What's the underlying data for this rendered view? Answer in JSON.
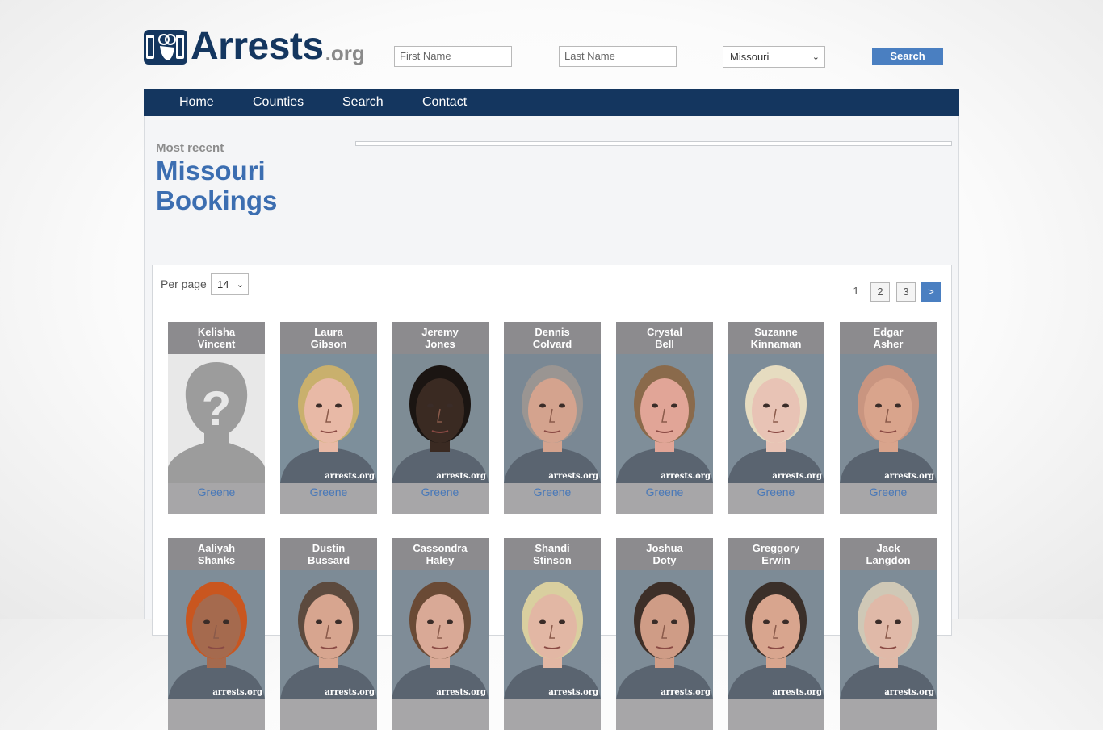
{
  "header": {
    "logo_word": "Arrests",
    "logo_tld": ".org",
    "first_name_placeholder": "First Name",
    "last_name_placeholder": "Last Name",
    "state_selected": "Missouri",
    "search_label": "Search"
  },
  "nav": {
    "items": [
      "Home",
      "Counties",
      "Search",
      "Contact"
    ]
  },
  "main": {
    "eyebrow": "Most recent",
    "title_line1": "Missouri",
    "title_line2": "Bookings"
  },
  "listing": {
    "per_page_label": "Per page",
    "per_page_value": "14",
    "pagination": {
      "current": "1",
      "pages": [
        "2",
        "3"
      ],
      "next": ">"
    },
    "watermark": "arrests.org",
    "cards": [
      {
        "first": "Kelisha",
        "last": "Vincent",
        "county": "Greene",
        "photo": "placeholder-silhouette",
        "bg": "#e8e8e8",
        "skin": "",
        "hair": ""
      },
      {
        "first": "Laura",
        "last": "Gibson",
        "county": "Greene",
        "photo": "mugshot",
        "bg": "#7d8f9b",
        "skin": "#e8b9a6",
        "hair": "#c9b06d"
      },
      {
        "first": "Jeremy",
        "last": "Jones",
        "county": "Greene",
        "photo": "mugshot",
        "bg": "#7e8c95",
        "skin": "#3a2a22",
        "hair": "#1b1512"
      },
      {
        "first": "Dennis",
        "last": "Colvard",
        "county": "Greene",
        "photo": "mugshot",
        "bg": "#7a8894",
        "skin": "#d4a38e",
        "hair": "#9a9592"
      },
      {
        "first": "Crystal",
        "last": "Bell",
        "county": "Greene",
        "photo": "mugshot",
        "bg": "#7f8e99",
        "skin": "#e1a597",
        "hair": "#8a6a4b"
      },
      {
        "first": "Suzanne",
        "last": "Kinnaman",
        "county": "Greene",
        "photo": "mugshot",
        "bg": "#7d8c98",
        "skin": "#e8c3b5",
        "hair": "#e6dcc0"
      },
      {
        "first": "Edgar",
        "last": "Asher",
        "county": "Greene",
        "photo": "mugshot",
        "bg": "#7e8c97",
        "skin": "#d9a48c",
        "hair": "#c99580"
      },
      {
        "first": "Aaliyah",
        "last": "Shanks",
        "county": "",
        "photo": "mugshot",
        "bg": "#7f8d98",
        "skin": "#a56a4e",
        "hair": "#c9561f"
      },
      {
        "first": "Dustin",
        "last": "Bussard",
        "county": "",
        "photo": "mugshot",
        "bg": "#7d8b96",
        "skin": "#d7a58f",
        "hair": "#5c4a3e"
      },
      {
        "first": "Cassondra",
        "last": "Haley",
        "county": "",
        "photo": "mugshot",
        "bg": "#7f8c97",
        "skin": "#d9a996",
        "hair": "#6a4a35"
      },
      {
        "first": "Shandi",
        "last": "Stinson",
        "county": "",
        "photo": "mugshot",
        "bg": "#7d8b97",
        "skin": "#e2b7a4",
        "hair": "#d9cf9f"
      },
      {
        "first": "Joshua",
        "last": "Doty",
        "county": "",
        "photo": "mugshot",
        "bg": "#7e8c97",
        "skin": "#cf9c86",
        "hair": "#3d2f28"
      },
      {
        "first": "Greggory",
        "last": "Erwin",
        "county": "",
        "photo": "mugshot",
        "bg": "#7d8b96",
        "skin": "#d8a58e",
        "hair": "#3a2f29"
      },
      {
        "first": "Jack",
        "last": "Langdon",
        "county": "",
        "photo": "mugshot",
        "bg": "#7e8c97",
        "skin": "#e0b9a8",
        "hair": "#cfc8b6"
      }
    ]
  },
  "colors": {
    "brand_navy": "#14365f",
    "accent_blue": "#4a7fc1",
    "title_blue": "#3c6eb1",
    "card_gray": "#a7a6a8"
  }
}
